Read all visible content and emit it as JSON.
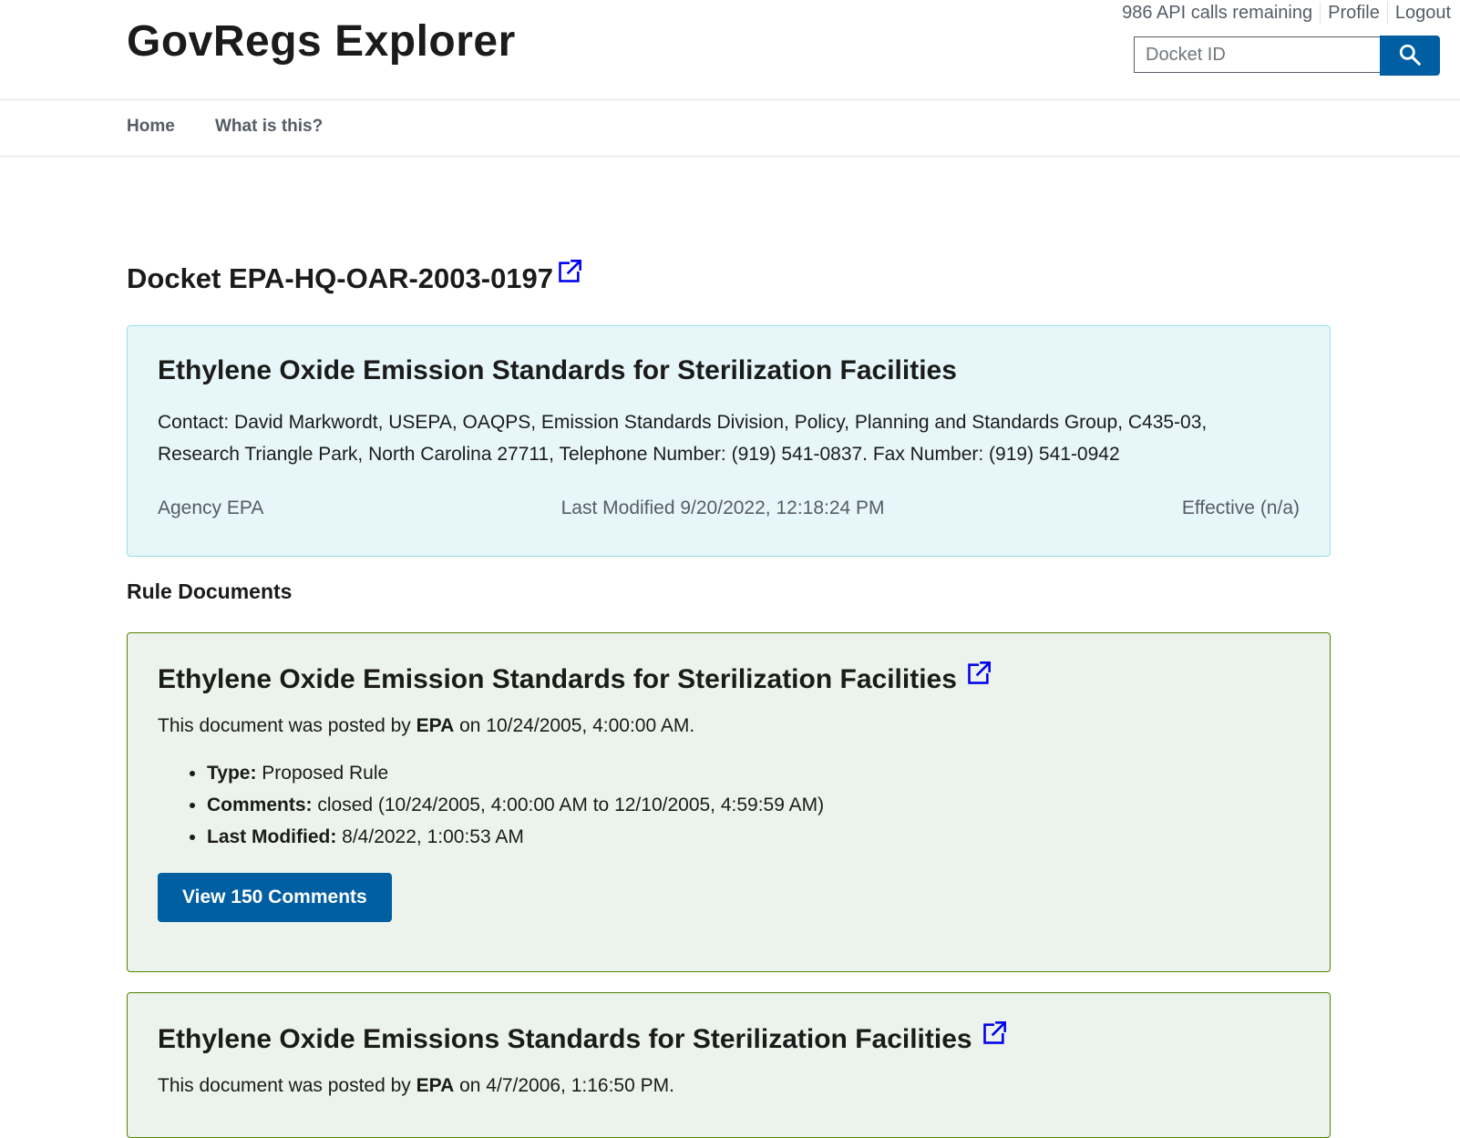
{
  "header": {
    "site_title": "GovRegs Explorer",
    "api_calls": "986 API calls remaining",
    "profile_link": "Profile",
    "logout_link": "Logout",
    "search_placeholder": "Docket ID"
  },
  "nav": {
    "items": [
      {
        "label": "Home"
      },
      {
        "label": "What is this?"
      }
    ]
  },
  "docket": {
    "heading": "Docket EPA-HQ-OAR-2003-0197",
    "title": "Ethylene Oxide Emission Standards for Sterilization Facilities",
    "contact": "Contact: David Markwordt, USEPA, OAQPS, Emission Standards Division, Policy, Planning and Standards Group, C435-03, Research Triangle Park, North Carolina 27711, Telephone Number: (919) 541-0837. Fax Number: (919) 541-0942",
    "agency": "Agency EPA",
    "last_modified": "Last Modified 9/20/2022, 12:18:24 PM",
    "effective": "Effective (n/a)"
  },
  "rule_documents": {
    "heading": "Rule Documents",
    "items": [
      {
        "title": "Ethylene Oxide Emission Standards for Sterilization Facilities",
        "posted_prefix": "This document was posted by ",
        "posted_agency": "EPA",
        "posted_suffix": " on 10/24/2005, 4:00:00 AM.",
        "type_label": "Type:",
        "type_value": " Proposed Rule",
        "comments_label": "Comments:",
        "comments_value": " closed (10/24/2005, 4:00:00 AM to 12/10/2005, 4:59:59 AM)",
        "modified_label": "Last Modified:",
        "modified_value": " 8/4/2022, 1:00:53 AM",
        "button_label": "View 150 Comments"
      },
      {
        "title": "Ethylene Oxide Emissions Standards for Sterilization Facilities",
        "posted_prefix": "This document was posted by ",
        "posted_agency": "EPA",
        "posted_suffix": " on 4/7/2006, 1:16:50 PM."
      }
    ]
  },
  "colors": {
    "primary": "#005ea2",
    "summary_bg": "#e7f6f8",
    "summary_border": "#99deea",
    "doc_bg": "#ecf3ec",
    "doc_border": "#538200",
    "external_link": "#0000ee"
  },
  "icons": {
    "search": "search-icon",
    "external_link": "external-link-icon"
  }
}
